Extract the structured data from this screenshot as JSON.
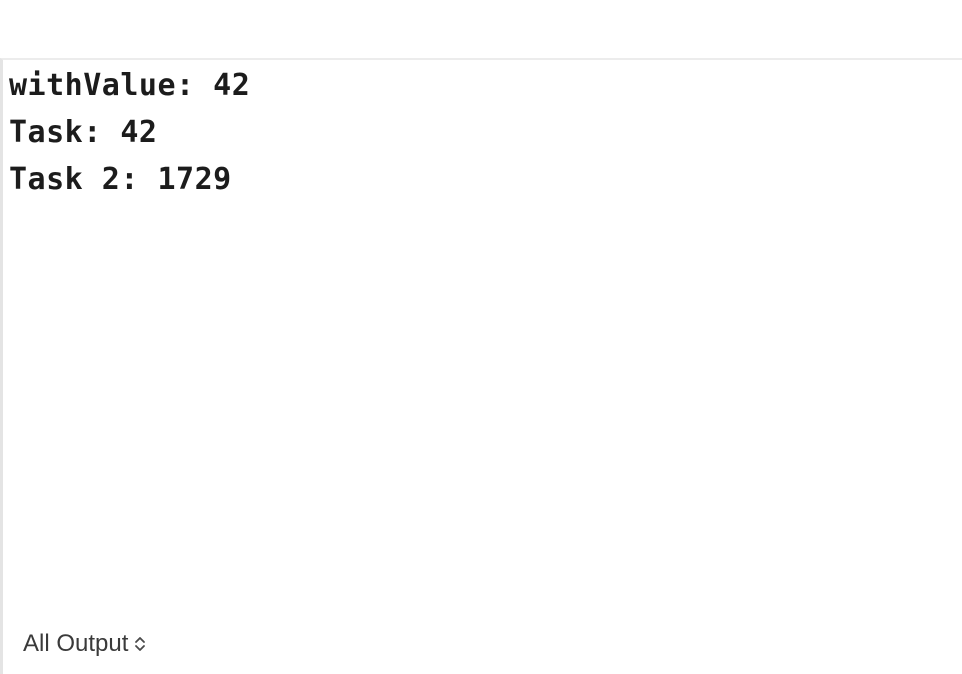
{
  "console": {
    "lines": [
      "withValue: 42",
      "Task: 42",
      "Task 2: 1729"
    ]
  },
  "filter": {
    "label": "All Output",
    "icon": "chevron-up-down-icon"
  }
}
